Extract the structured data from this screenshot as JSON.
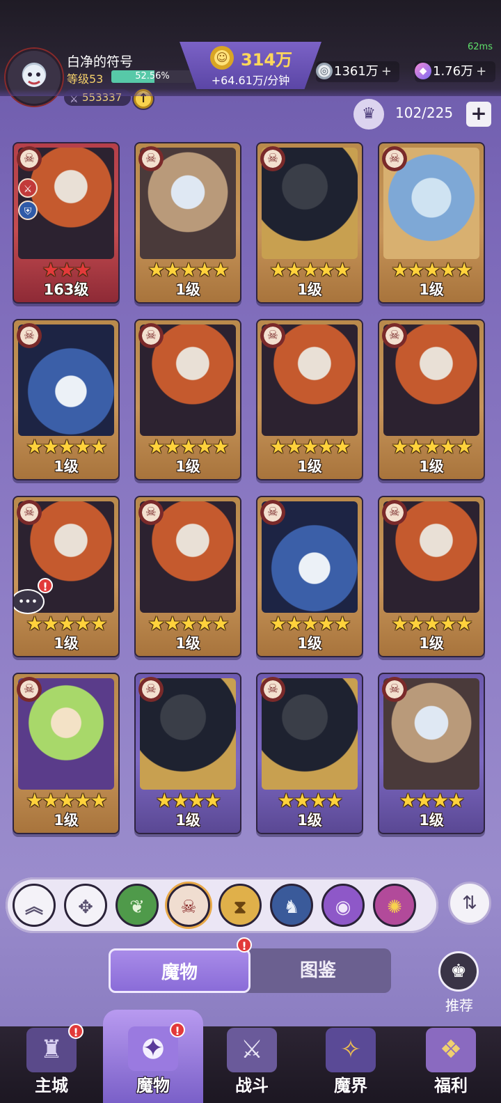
{
  "header": {
    "player_name": "白净的符号",
    "level_label": "等级53",
    "xp_percent_text": "52.56%",
    "xp_fraction": 0.5256,
    "power": "553337",
    "gold_amount": "314万",
    "gold_rate": "+64.61万/分钟",
    "ping": "62ms",
    "silver": "1361万",
    "crystal": "1.76万",
    "capacity": "102/225"
  },
  "cards": [
    {
      "art": "lion",
      "frame": "red",
      "stars": 3,
      "star_color": "red",
      "level": "163级",
      "has_side_icons": true
    },
    {
      "art": "bunny",
      "frame": "gold",
      "stars": 5,
      "star_color": "gold",
      "level": "1级"
    },
    {
      "art": "suit",
      "frame": "gold",
      "stars": 5,
      "star_color": "gold",
      "level": "1级"
    },
    {
      "art": "shark",
      "frame": "gold",
      "stars": 5,
      "star_color": "gold",
      "level": "1级"
    },
    {
      "art": "dragon",
      "frame": "gold",
      "stars": 5,
      "star_color": "gold",
      "level": "1级"
    },
    {
      "art": "lion",
      "frame": "gold",
      "stars": 5,
      "star_color": "gold",
      "level": "1级"
    },
    {
      "art": "lion",
      "frame": "gold",
      "stars": 5,
      "star_color": "gold",
      "level": "1级"
    },
    {
      "art": "lion",
      "frame": "gold",
      "stars": 5,
      "star_color": "gold",
      "level": "1级"
    },
    {
      "art": "lion",
      "frame": "gold",
      "stars": 5,
      "star_color": "gold",
      "level": "1级",
      "has_chat_alert": true
    },
    {
      "art": "lion",
      "frame": "gold",
      "stars": 5,
      "star_color": "gold",
      "level": "1级"
    },
    {
      "art": "dragon",
      "frame": "gold",
      "stars": 5,
      "star_color": "gold",
      "level": "1级"
    },
    {
      "art": "lion",
      "frame": "gold",
      "stars": 5,
      "star_color": "gold",
      "level": "1级"
    },
    {
      "art": "witch",
      "frame": "gold",
      "stars": 5,
      "star_color": "gold",
      "level": "1级"
    },
    {
      "art": "suit",
      "frame": "purple",
      "stars": 4,
      "star_color": "gold",
      "level": "1级"
    },
    {
      "art": "suit",
      "frame": "purple",
      "stars": 4,
      "star_color": "gold",
      "level": "1级"
    },
    {
      "art": "bunny",
      "frame": "purple",
      "stars": 4,
      "star_color": "gold",
      "level": "1级"
    }
  ],
  "filters": [
    {
      "name": "collapse-filter-button",
      "icon": "chevron-up-icon",
      "glyph": "︽",
      "cls": "fb-up"
    },
    {
      "name": "all-factions-filter-button",
      "icon": "diamond-grid-icon",
      "glyph": "✥",
      "cls": "fb-all"
    },
    {
      "name": "nature-faction-filter-button",
      "icon": "leaf-icon",
      "glyph": "❦",
      "cls": "fb-nature"
    },
    {
      "name": "demon-faction-filter-button",
      "icon": "demon-mask-icon",
      "glyph": "☠",
      "cls": "fb-demon"
    },
    {
      "name": "time-faction-filter-button",
      "icon": "hourglass-icon",
      "glyph": "⧗",
      "cls": "fb-time"
    },
    {
      "name": "dragon-faction-filter-button",
      "icon": "dragon-icon",
      "glyph": "♞",
      "cls": "fb-dragon"
    },
    {
      "name": "eye-faction-filter-button",
      "icon": "eye-icon",
      "glyph": "◉",
      "cls": "fb-eye"
    },
    {
      "name": "chaos-faction-filter-button",
      "icon": "swirl-icon",
      "glyph": "✺",
      "cls": "fb-chaos"
    }
  ],
  "tabs": {
    "monsters": "魔物",
    "codex": "图鉴"
  },
  "recommend_label": "推荐",
  "nav": [
    {
      "label": "主城",
      "icon": "castle-icon",
      "glyph": "♜",
      "cls": "ni-castle",
      "alert": true,
      "active": false
    },
    {
      "label": "魔物",
      "icon": "monster-flame-icon",
      "glyph": "✦",
      "cls": "ni-monster",
      "alert": true,
      "active": true
    },
    {
      "label": "战斗",
      "icon": "sword-shield-icon",
      "glyph": "⚔",
      "cls": "ni-battle",
      "alert": false,
      "active": false
    },
    {
      "label": "魔界",
      "icon": "demon-realm-icon",
      "glyph": "✧",
      "cls": "ni-demon",
      "alert": false,
      "active": false
    },
    {
      "label": "福利",
      "icon": "treasure-chest-icon",
      "glyph": "❖",
      "cls": "ni-gift",
      "alert": false,
      "active": false
    }
  ]
}
